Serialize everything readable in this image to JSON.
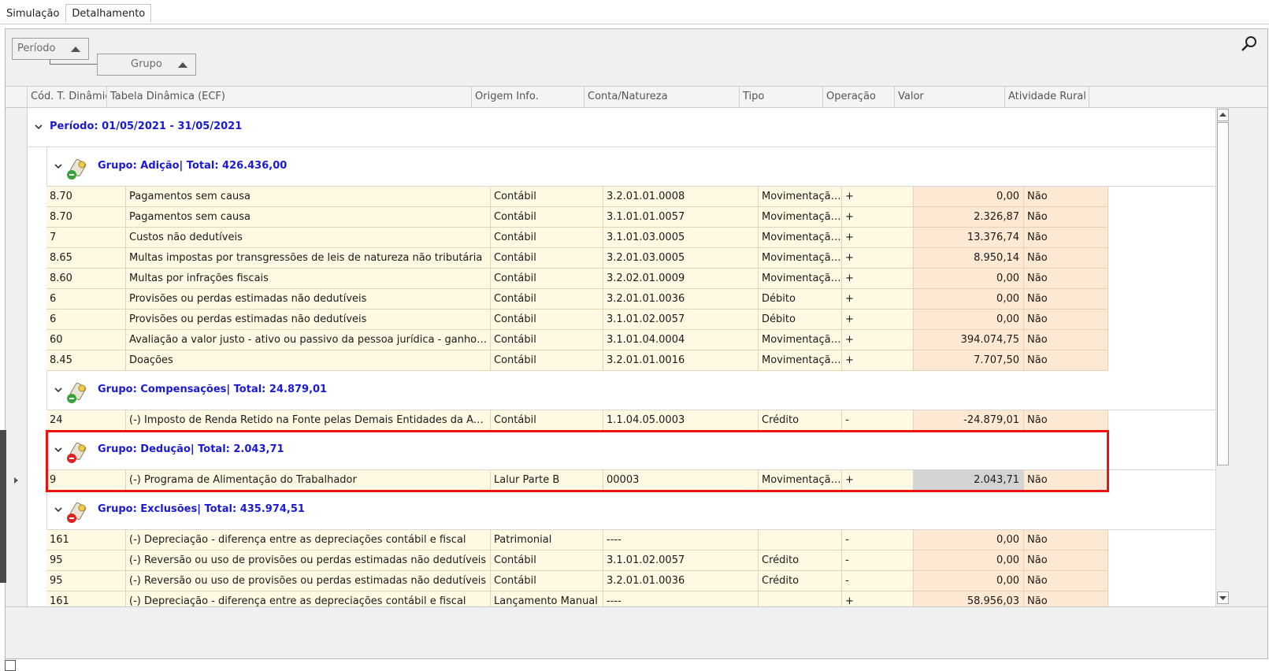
{
  "tabs": [
    {
      "label": "Simulação",
      "active": false
    },
    {
      "label": "Detalhamento",
      "active": true
    }
  ],
  "groupby": {
    "periodo": "Período",
    "grupo": "Grupo"
  },
  "columns": [
    "Cód. T. Dinâmica",
    "Tabela Dinâmica (ECF)",
    "Origem Info.",
    "Conta/Natureza",
    "Tipo",
    "Operação",
    "Valor",
    "Atividade Rural"
  ],
  "period": {
    "label": "Período: 01/05/2021 - 31/05/2021"
  },
  "groups": [
    {
      "label": "Grupo: Adição| Total: 426.436,00",
      "icon": "add-group-icon",
      "rows": [
        [
          "8.70",
          "Pagamentos sem causa",
          "Contábil",
          "3.2.01.01.0008",
          "Movimentação...",
          "+",
          "0,00",
          "Não"
        ],
        [
          "8.70",
          "Pagamentos sem causa",
          "Contábil",
          "3.1.01.01.0057",
          "Movimentação...",
          "+",
          "2.326,87",
          "Não"
        ],
        [
          "7",
          "Custos não dedutíveis",
          "Contábil",
          "3.1.01.03.0005",
          "Movimentação...",
          "+",
          "13.376,74",
          "Não"
        ],
        [
          "8.65",
          "Multas impostas por transgressões de leis de natureza não tributária",
          "Contábil",
          "3.2.01.03.0005",
          "Movimentação...",
          "+",
          "8.950,14",
          "Não"
        ],
        [
          "8.60",
          "Multas por infrações fiscais",
          "Contábil",
          "3.2.02.01.0009",
          "Movimentação...",
          "+",
          "0,00",
          "Não"
        ],
        [
          "6",
          "Provisões ou perdas estimadas não dedutíveis",
          "Contábil",
          "3.2.01.01.0036",
          "Débito",
          "+",
          "0,00",
          "Não"
        ],
        [
          "6",
          "Provisões ou perdas estimadas não dedutíveis",
          "Contábil",
          "3.1.01.02.0057",
          "Débito",
          "+",
          "0,00",
          "Não"
        ],
        [
          "60",
          "Avaliação a valor justo - ativo ou passivo da pessoa jurídica - ganho - contr...",
          "Contábil",
          "3.1.01.04.0004",
          "Movimentação...",
          "+",
          "394.074,75",
          "Não"
        ],
        [
          "8.45",
          "Doações",
          "Contábil",
          "3.2.01.01.0016",
          "Movimentação...",
          "+",
          "7.707,50",
          "Não"
        ]
      ]
    },
    {
      "label": "Grupo: Compensações| Total: 24.879,01",
      "icon": "compensation-group-icon",
      "rows": [
        [
          "24",
          "(-) Imposto de Renda Retido na Fonte pelas Demais Entidades da Administr...",
          "Contábil",
          "1.1.04.05.0003",
          "Crédito",
          "-",
          "-24.879,01",
          "Não"
        ]
      ]
    },
    {
      "label": "Grupo: Dedução| Total: 2.043,71",
      "icon": "deduction-group-icon",
      "rows": [
        [
          "9",
          "(-) Programa de Alimentação do Trabalhador",
          "Lalur Parte B",
          "00003",
          "Movimentação...",
          "+",
          "2.043,71",
          "Não"
        ]
      ]
    },
    {
      "label": "Grupo: Exclusões| Total: 435.974,51",
      "icon": "exclusion-group-icon",
      "rows": [
        [
          "161",
          "(-) Depreciação - diferença entre as depreciações contábil e fiscal",
          "Patrimonial",
          "----",
          "",
          "-",
          "0,00",
          "Não"
        ],
        [
          "95",
          "(-) Reversão ou uso de provisões ou perdas estimadas não dedutíveis",
          "Contábil",
          "3.1.01.02.0057",
          "Crédito",
          "-",
          "0,00",
          "Não"
        ],
        [
          "95",
          "(-) Reversão ou uso de provisões ou perdas estimadas não dedutíveis",
          "Contábil",
          "3.2.01.01.0036",
          "Crédito",
          "-",
          "0,00",
          "Não"
        ],
        [
          "161",
          "(-) Depreciação - diferença entre as depreciações contábil e fiscal",
          "Lançamento Manual",
          "----",
          "",
          "+",
          "58.956,03",
          "Não"
        ]
      ]
    }
  ]
}
